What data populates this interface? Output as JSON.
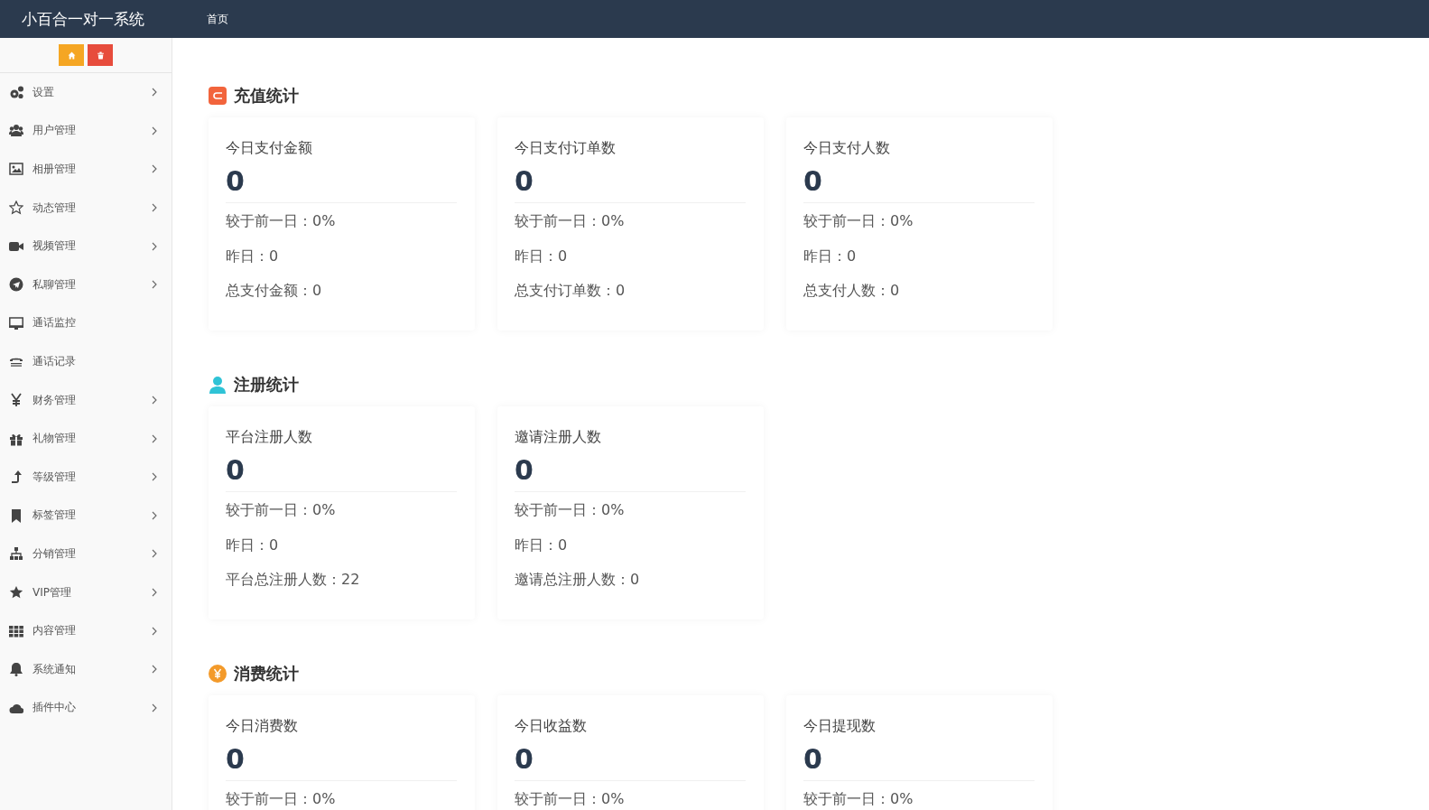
{
  "header": {
    "title": "小百合一对一系统",
    "nav": [
      {
        "label": "首页"
      }
    ]
  },
  "sidebar": {
    "quick_buttons": [
      {
        "kind": "home"
      },
      {
        "kind": "delete"
      }
    ],
    "items": [
      {
        "label": "设置",
        "expandable": true
      },
      {
        "label": "用户管理",
        "expandable": true
      },
      {
        "label": "相册管理",
        "expandable": true
      },
      {
        "label": "动态管理",
        "expandable": true
      },
      {
        "label": "视频管理",
        "expandable": true
      },
      {
        "label": "私聊管理",
        "expandable": true
      },
      {
        "label": "通话监控",
        "expandable": false
      },
      {
        "label": "通话记录",
        "expandable": false
      },
      {
        "label": "财务管理",
        "expandable": true
      },
      {
        "label": "礼物管理",
        "expandable": true
      },
      {
        "label": "等级管理",
        "expandable": true
      },
      {
        "label": "标签管理",
        "expandable": true
      },
      {
        "label": "分销管理",
        "expandable": true
      },
      {
        "label": "VIP管理",
        "expandable": true
      },
      {
        "label": "内容管理",
        "expandable": true
      },
      {
        "label": "系统通知",
        "expandable": true
      },
      {
        "label": "插件中心",
        "expandable": true
      }
    ]
  },
  "sections": [
    {
      "title": "充值统计",
      "cards": [
        {
          "label": "今日支付金额",
          "value": "0",
          "lines": [
            "较于前一日：0%",
            "昨日：0",
            "总支付金额：0"
          ]
        },
        {
          "label": "今日支付订单数",
          "value": "0",
          "lines": [
            "较于前一日：0%",
            "昨日：0",
            "总支付订单数：0"
          ]
        },
        {
          "label": "今日支付人数",
          "value": "0",
          "lines": [
            "较于前一日：0%",
            "昨日：0",
            "总支付人数：0"
          ]
        }
      ]
    },
    {
      "title": "注册统计",
      "cards": [
        {
          "label": "平台注册人数",
          "value": "0",
          "lines": [
            "较于前一日：0%",
            "昨日：0",
            "平台总注册人数：22"
          ]
        },
        {
          "label": "邀请注册人数",
          "value": "0",
          "lines": [
            "较于前一日：0%",
            "昨日：0",
            "邀请总注册人数：0"
          ]
        }
      ]
    },
    {
      "title": "消费统计",
      "cards": [
        {
          "label": "今日消费数",
          "value": "0",
          "lines": [
            "较于前一日：0%"
          ]
        },
        {
          "label": "今日收益数",
          "value": "0",
          "lines": [
            "较于前一日：0%"
          ]
        },
        {
          "label": "今日提现数",
          "value": "0",
          "lines": [
            "较于前一日：0%"
          ]
        }
      ]
    }
  ]
}
